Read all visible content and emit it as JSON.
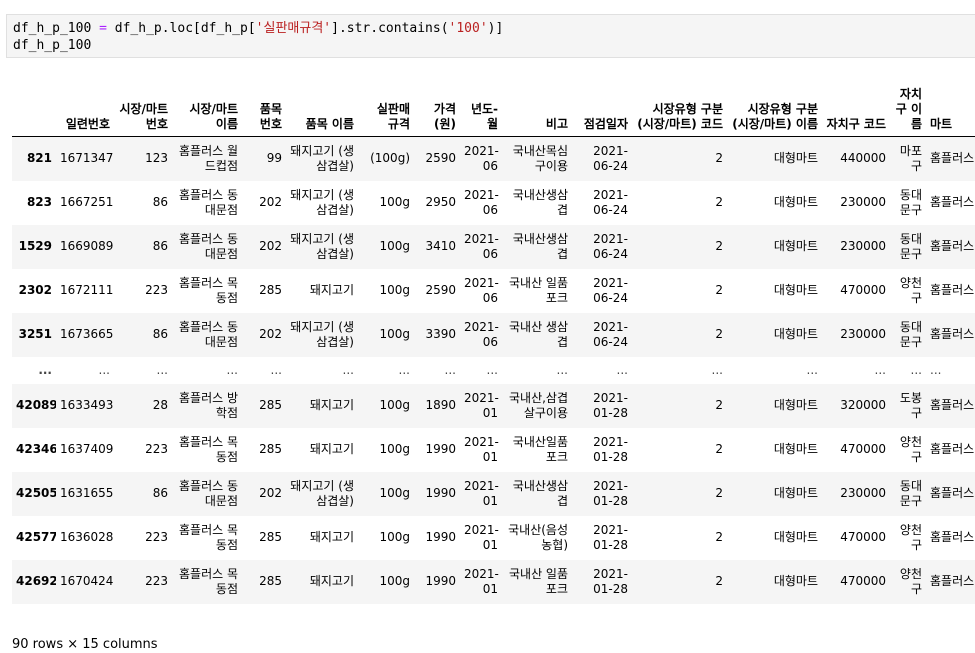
{
  "code": {
    "line1_var": "df_h_p_100",
    "line1_op": " = ",
    "line1_pre": "df_h_p.loc[df_h_p[",
    "line1_str1": "'실판매규격'",
    "line1_mid": "].str.contains(",
    "line1_str2": "'100'",
    "line1_post": ")]",
    "line2": "df_h_p_100"
  },
  "columns": [
    "",
    "일련번호",
    "시장/마트 번호",
    "시장/마트 이름",
    "품목 번호",
    "품목 이름",
    "실판매 규격",
    "가격 (원)",
    "년도-월",
    "비고",
    "점검일자",
    "시장유형 구분 (시장/마트) 코드",
    "시장유형 구분 (시장/마트) 이름",
    "자치구 코드",
    "자치구 이름",
    "마트"
  ],
  "rows": [
    [
      "821",
      "1671347",
      "123",
      "홈플러스 월드컵점",
      "99",
      "돼지고기 (생삼겹살)",
      "(100g)",
      "2590",
      "2021-06",
      "국내산목심구이용",
      "2021-06-24",
      "2",
      "대형마트",
      "440000",
      "마포구",
      "홈플러스"
    ],
    [
      "823",
      "1667251",
      "86",
      "홈플러스 동대문점",
      "202",
      "돼지고기 (생삼겹살)",
      "100g",
      "2950",
      "2021-06",
      "국내산생삼겹",
      "2021-06-24",
      "2",
      "대형마트",
      "230000",
      "동대문구",
      "홈플러스"
    ],
    [
      "1529",
      "1669089",
      "86",
      "홈플러스 동대문점",
      "202",
      "돼지고기 (생삼겹살)",
      "100g",
      "3410",
      "2021-06",
      "국내산생삼겹",
      "2021-06-24",
      "2",
      "대형마트",
      "230000",
      "동대문구",
      "홈플러스"
    ],
    [
      "2302",
      "1672111",
      "223",
      "홈플러스 목동점",
      "285",
      "돼지고기",
      "100g",
      "2590",
      "2021-06",
      "국내산 일품포크",
      "2021-06-24",
      "2",
      "대형마트",
      "470000",
      "양천구",
      "홈플러스"
    ],
    [
      "3251",
      "1673665",
      "86",
      "홈플러스 동대문점",
      "202",
      "돼지고기 (생삼겹살)",
      "100g",
      "3390",
      "2021-06",
      "국내산 생삼겹",
      "2021-06-24",
      "2",
      "대형마트",
      "230000",
      "동대문구",
      "홈플러스"
    ],
    [
      "...",
      "...",
      "...",
      "...",
      "...",
      "...",
      "...",
      "...",
      "...",
      "...",
      "...",
      "...",
      "...",
      "...",
      "...",
      "..."
    ],
    [
      "42089",
      "1633493",
      "28",
      "홈플러스 방학점",
      "285",
      "돼지고기",
      "100g",
      "1890",
      "2021-01",
      "국내산,삼겹살구이용",
      "2021-01-28",
      "2",
      "대형마트",
      "320000",
      "도봉구",
      "홈플러스"
    ],
    [
      "42346",
      "1637409",
      "223",
      "홈플러스 목동점",
      "285",
      "돼지고기",
      "100g",
      "1990",
      "2021-01",
      "국내산일품포크",
      "2021-01-28",
      "2",
      "대형마트",
      "470000",
      "양천구",
      "홈플러스"
    ],
    [
      "42505",
      "1631655",
      "86",
      "홈플러스 동대문점",
      "202",
      "돼지고기 (생삼겹살)",
      "100g",
      "1990",
      "2021-01",
      "국내산생삼겹",
      "2021-01-28",
      "2",
      "대형마트",
      "230000",
      "동대문구",
      "홈플러스"
    ],
    [
      "42577",
      "1636028",
      "223",
      "홈플러스 목동점",
      "285",
      "돼지고기",
      "100g",
      "1990",
      "2021-01",
      "국내산(음성농협)",
      "2021-01-28",
      "2",
      "대형마트",
      "470000",
      "양천구",
      "홈플러스"
    ],
    [
      "42692",
      "1670424",
      "223",
      "홈플러스 목동점",
      "285",
      "돼지고기",
      "100g",
      "1990",
      "2021-01",
      "국내산 일품포크",
      "2021-01-28",
      "2",
      "대형마트",
      "470000",
      "양천구",
      "홈플러스"
    ]
  ],
  "footer": "90 rows × 15 columns"
}
